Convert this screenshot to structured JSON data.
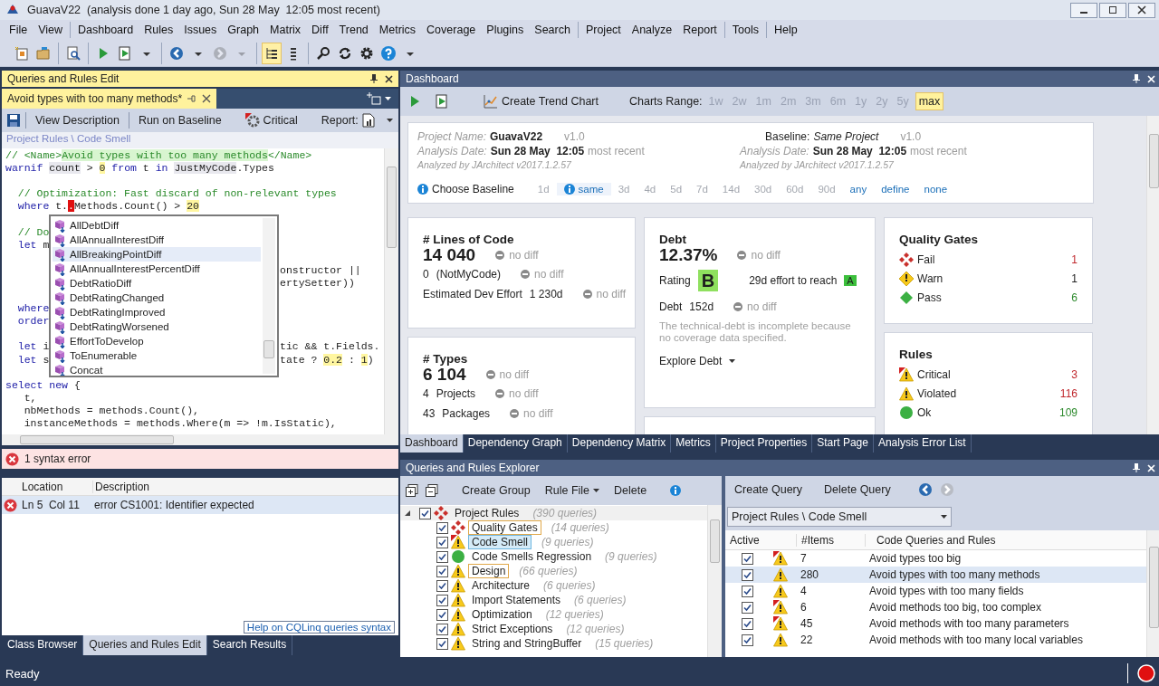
{
  "title_bar": {
    "title": "GuavaV22  (analysis done 1 day ago, Sun 28 May  12:05 most recent)"
  },
  "menu": [
    [
      "File",
      "View"
    ],
    [
      "Dashboard",
      "Rules",
      "Issues",
      "Graph",
      "Matrix",
      "Diff",
      "Trend",
      "Metrics",
      "Coverage",
      "Plugins",
      "Search"
    ],
    [
      "Project",
      "Analyze",
      "Report"
    ],
    [
      "Tools"
    ],
    [
      "Help"
    ]
  ],
  "toolbar": [
    [
      {
        "pressed": false,
        "disabled": false
      },
      {
        "pressed": false,
        "disabled": false
      }
    ],
    [
      {
        "pressed": false,
        "disabled": false
      }
    ],
    [
      {
        "pressed": false,
        "disabled": false
      },
      {
        "pressed": false,
        "disabled": false
      },
      {
        "pressed": false,
        "disabled": false
      }
    ],
    [
      {
        "pressed": false,
        "disabled": false
      },
      {
        "pressed": false,
        "disabled": false
      },
      {
        "pressed": false,
        "disabled": true
      },
      {
        "pressed": false,
        "disabled": true
      }
    ],
    [
      {
        "pressed": true,
        "disabled": false
      },
      {
        "pressed": false,
        "disabled": false
      }
    ],
    [
      {
        "pressed": false,
        "disabled": false
      },
      {
        "pressed": false,
        "disabled": false
      },
      {
        "pressed": false,
        "disabled": false
      },
      {
        "pressed": false,
        "disabled": false
      },
      {
        "pressed": false,
        "disabled": false
      }
    ]
  ],
  "query_editor": {
    "panel_title": "Queries and Rules Edit",
    "document_tab": "Avoid types with too many methods*",
    "toolbar": [
      "View Description",
      "Run on Baseline"
    ],
    "severity": "Critical",
    "report_label": "Report:",
    "breadcrumb": "Project Rules \\ Code Smell",
    "code_lines": [
      {
        "kind": "code",
        "left": [
          {
            "text": "// <Name>",
            "kind": "comment"
          },
          {
            "text": "Avoid types with too many methods",
            "kind": "name"
          },
          {
            "text": "</Name>",
            "kind": "comment"
          }
        ]
      },
      {
        "kind": "code",
        "left": [
          {
            "text": "warnif ",
            "kind": "keyword"
          },
          {
            "text": "count",
            "kind": "ident"
          },
          {
            "text": " > ",
            "kind": "plain"
          },
          {
            "text": "0",
            "kind": "number"
          },
          {
            "text": " from",
            "kind": "keyword"
          },
          {
            "text": " t ",
            "kind": "plain"
          },
          {
            "text": "in ",
            "kind": "keyword"
          },
          {
            "text": "JustMyCode",
            "kind": "ident"
          },
          {
            "text": ".Types",
            "kind": "plain"
          }
        ]
      },
      {
        "kind": "blank"
      },
      {
        "kind": "code",
        "left": [
          {
            "text": "  // Optimization: Fast discard of non-relevant types",
            "kind": "comment"
          }
        ]
      },
      {
        "kind": "code",
        "left": [
          {
            "text": "  where",
            "kind": "keyword"
          },
          {
            "text": " t.",
            "kind": "plain"
          },
          {
            "text": ".",
            "kind": "error"
          },
          {
            "text": "Methods.Count() > ",
            "kind": "plain"
          },
          {
            "text": "20",
            "kind": "number"
          }
        ]
      },
      {
        "kind": "blank"
      },
      {
        "kind": "code",
        "left": [
          {
            "text": "  // Do",
            "kind": "comment"
          }
        ]
      },
      {
        "kind": "code",
        "left": [
          {
            "text": "  let",
            "kind": "keyword"
          },
          {
            "text": " m",
            "kind": "plain"
          }
        ]
      },
      {
        "kind": "blank"
      },
      {
        "kind": "code",
        "right": [
          {
            "text": "onstructor ||",
            "kind": "plain"
          }
        ]
      },
      {
        "kind": "code",
        "right": [
          {
            "text": "ertySetter))",
            "kind": "plain"
          }
        ]
      },
      {
        "kind": "blank"
      },
      {
        "kind": "code",
        "left": [
          {
            "text": "  where",
            "kind": "keyword"
          }
        ]
      },
      {
        "kind": "code",
        "left": [
          {
            "text": "  order",
            "kind": "keyword"
          }
        ]
      },
      {
        "kind": "blank"
      },
      {
        "kind": "code",
        "left": [
          {
            "text": "  let",
            "kind": "keyword"
          },
          {
            "text": " i",
            "kind": "plain"
          }
        ],
        "right": [
          {
            "text": "tic && t.Fields.",
            "kind": "plain"
          }
        ]
      },
      {
        "kind": "code",
        "left": [
          {
            "text": "  let",
            "kind": "keyword"
          },
          {
            "text": " s",
            "kind": "plain"
          }
        ],
        "right": [
          {
            "text": "tate ? ",
            "kind": "plain"
          },
          {
            "text": "0.2",
            "kind": "number"
          },
          {
            "text": " : ",
            "kind": "plain"
          },
          {
            "text": "1",
            "kind": "number"
          },
          {
            "text": ")",
            "kind": "plain"
          }
        ]
      },
      {
        "kind": "blank"
      },
      {
        "kind": "code",
        "left": [
          {
            "text": "select new",
            "kind": "keyword"
          },
          {
            "text": " {",
            "kind": "plain"
          }
        ]
      },
      {
        "kind": "code",
        "left": [
          {
            "text": "   t,",
            "kind": "plain"
          }
        ]
      },
      {
        "kind": "code",
        "left": [
          {
            "text": "   nbMethods = methods.Count(),",
            "kind": "plain"
          }
        ]
      },
      {
        "kind": "code",
        "left": [
          {
            "text": "   instanceMethods = methods.Where(m => !m.IsStatic),",
            "kind": "plain"
          }
        ]
      }
    ],
    "completion": [
      {
        "label": "AllDebtDiff",
        "selected": false
      },
      {
        "label": "AllAnnualInterestDiff",
        "selected": false
      },
      {
        "label": "AllBreakingPointDiff",
        "selected": true
      },
      {
        "label": "AllAnnualInterestPercentDiff",
        "selected": false
      },
      {
        "label": "DebtRatioDiff",
        "selected": false
      },
      {
        "label": "DebtRatingChanged",
        "selected": false
      },
      {
        "label": "DebtRatingImproved",
        "selected": false
      },
      {
        "label": "DebtRatingWorsened",
        "selected": false
      },
      {
        "label": "EffortToDevelop",
        "selected": false
      },
      {
        "label": "ToEnumerable",
        "selected": false
      },
      {
        "label": "Concat",
        "selected": false
      }
    ],
    "status": "1 syntax error",
    "errors": {
      "columns": [
        "Location",
        "Description"
      ],
      "rows": [
        {
          "location": "Ln 5  Col 11",
          "description": "error CS1001: Identifier expected",
          "selected": true
        }
      ]
    },
    "help_link": "Help on CQLinq queries syntax"
  },
  "left_tabs": [
    {
      "label": "Class Browser",
      "selected": false
    },
    {
      "label": "Queries and Rules Edit",
      "selected": true
    },
    {
      "label": "Search Results",
      "selected": false
    }
  ],
  "dashboard": {
    "panel_title": "Dashboard",
    "trend_button": "Create Trend Chart",
    "range_label": "Charts Range:",
    "ranges": [
      {
        "label": "1w",
        "selected": false
      },
      {
        "label": "2w",
        "selected": false
      },
      {
        "label": "1m",
        "selected": false
      },
      {
        "label": "2m",
        "selected": false
      },
      {
        "label": "3m",
        "selected": false
      },
      {
        "label": "6m",
        "selected": false
      },
      {
        "label": "1y",
        "selected": false
      },
      {
        "label": "2y",
        "selected": false
      },
      {
        "label": "5y",
        "selected": false
      },
      {
        "label": "max",
        "selected": true
      }
    ],
    "project": {
      "name_label": "Project Name:",
      "name": "GuavaV22",
      "version": "v1.0",
      "date_label": "Analysis Date:",
      "date": "Sun 28 May  12:05",
      "date_note": "most recent",
      "analyzer": "Analyzed by JArchitect v2017.1.2.57"
    },
    "baseline": {
      "label": "Baseline:",
      "name": "Same Project",
      "version": "v1.0",
      "date_label": "Analysis Date:",
      "date": "Sun 28 May  12:05",
      "date_note": "most recent",
      "analyzer": "Analyzed by JArchitect v2017.1.2.57"
    },
    "choose_baseline": "Choose Baseline",
    "baseline_options": [
      {
        "label": "1d",
        "selected": false,
        "disabled": true
      },
      {
        "label": "same",
        "selected": true,
        "disabled": false
      },
      {
        "label": "3d",
        "selected": false,
        "disabled": true
      },
      {
        "label": "4d",
        "selected": false,
        "disabled": true
      },
      {
        "label": "5d",
        "selected": false,
        "disabled": true
      },
      {
        "label": "7d",
        "selected": false,
        "disabled": true
      },
      {
        "label": "14d",
        "selected": false,
        "disabled": true
      },
      {
        "label": "30d",
        "selected": false,
        "disabled": true
      },
      {
        "label": "60d",
        "selected": false,
        "disabled": true
      },
      {
        "label": "90d",
        "selected": false,
        "disabled": true
      },
      {
        "label": "any",
        "selected": false,
        "disabled": false
      },
      {
        "label": "define",
        "selected": false,
        "disabled": false
      },
      {
        "label": "none",
        "selected": false,
        "disabled": false
      }
    ],
    "lines_of_code": {
      "title": "# Lines of Code",
      "value": "14 040",
      "diff": "no diff",
      "rows": [
        {
          "parts": [
            "0",
            "(NotMyCode)"
          ],
          "diff": "no diff"
        },
        {
          "parts": [
            "Estimated Dev Effort",
            "1 230d"
          ],
          "diff": "no diff"
        }
      ]
    },
    "types": {
      "title": "# Types",
      "value": "6 104",
      "diff": "no diff",
      "rows": [
        {
          "parts": [
            "4",
            "Projects"
          ],
          "diff": "no diff"
        },
        {
          "parts": [
            "43",
            "Packages"
          ],
          "diff": "no diff"
        }
      ]
    },
    "debt": {
      "title": "Debt",
      "value": "12.37%",
      "diff": "no diff",
      "rating_label": "Rating",
      "rating": "B",
      "effort": "29d effort to reach",
      "target_rating": "A",
      "row": {
        "parts": [
          "Debt",
          "152d"
        ],
        "diff": "no diff"
      },
      "note": "The technical-debt is incomplete because no coverage data specified.",
      "explore": "Explore Debt"
    },
    "quality_gates": {
      "title": "Quality Gates",
      "rows": [
        {
          "kind": "fail",
          "label": "Fail",
          "count": "1"
        },
        {
          "kind": "warning",
          "label": "Warn",
          "count": "1"
        },
        {
          "kind": "pass",
          "label": "Pass",
          "count": "6"
        }
      ]
    },
    "rules": {
      "title": "Rules",
      "rows": [
        {
          "kind": "critical",
          "label": "Critical",
          "count": "3"
        },
        {
          "kind": "violated",
          "label": "Violated",
          "count": "116"
        },
        {
          "kind": "ok",
          "label": "Ok",
          "count": "109"
        }
      ]
    },
    "tabs": [
      {
        "label": "Dashboard",
        "selected": true
      },
      {
        "label": "Dependency Graph",
        "selected": false
      },
      {
        "label": "Dependency Matrix",
        "selected": false
      },
      {
        "label": "Metrics",
        "selected": false
      },
      {
        "label": "Project Properties",
        "selected": false
      },
      {
        "label": "Start Page",
        "selected": false
      },
      {
        "label": "Analysis Error List",
        "selected": false
      }
    ]
  },
  "explorer": {
    "panel_title": "Queries and Rules Explorer",
    "toolbar": [
      "Create Group",
      "Rule File",
      "Delete"
    ],
    "tree": {
      "label": "Project Rules",
      "count": "(390 queries)",
      "kind": "fail",
      "checked": true,
      "expanded": true,
      "children": [
        {
          "label": "Quality Gates",
          "count": "(14 queries)",
          "kind": "fail",
          "checked": true,
          "selected": false,
          "outlined": true
        },
        {
          "label": "Code Smell",
          "count": "(9 queries)",
          "kind": "critical",
          "checked": true,
          "selected": true,
          "outlined": false
        },
        {
          "label": "Code Smells Regression",
          "count": "(9 queries)",
          "kind": "ok",
          "checked": true,
          "selected": false,
          "outlined": false
        },
        {
          "label": "Design",
          "count": "(66 queries)",
          "kind": "violated",
          "checked": true,
          "selected": false,
          "outlined": true
        },
        {
          "label": "Architecture",
          "count": "(6 queries)",
          "kind": "violated",
          "checked": true,
          "selected": false,
          "outlined": false
        },
        {
          "label": "Import Statements",
          "count": "(6 queries)",
          "kind": "violated",
          "checked": true,
          "selected": false,
          "outlined": false
        },
        {
          "label": "Optimization",
          "count": "(12 queries)",
          "kind": "violated",
          "checked": true,
          "selected": false,
          "outlined": false
        },
        {
          "label": "Strict Exceptions",
          "count": "(12 queries)",
          "kind": "violated",
          "checked": true,
          "selected": false,
          "outlined": false
        },
        {
          "label": "String and StringBuffer",
          "count": "(15 queries)",
          "kind": "violated",
          "checked": true,
          "selected": false,
          "outlined": false
        }
      ]
    },
    "query_toolbar": [
      "Create Query",
      "Delete Query"
    ],
    "group": "Project Rules \\ Code Smell",
    "columns": [
      "Active",
      "#Items",
      "Code Queries and Rules"
    ],
    "rows": [
      {
        "active": true,
        "kind": "critical",
        "items": "7",
        "name": "Avoid types too big",
        "selected": false
      },
      {
        "active": true,
        "kind": "violated",
        "items": "280",
        "name": "Avoid types with too many methods",
        "selected": true
      },
      {
        "active": true,
        "kind": "violated",
        "items": "4",
        "name": "Avoid types with too many fields",
        "selected": false
      },
      {
        "active": true,
        "kind": "critical",
        "items": "6",
        "name": "Avoid methods too big, too complex",
        "selected": false
      },
      {
        "active": true,
        "kind": "critical",
        "items": "45",
        "name": "Avoid methods with too many parameters",
        "selected": false
      },
      {
        "active": true,
        "kind": "violated",
        "items": "22",
        "name": "Avoid methods with too many local variables",
        "selected": false
      }
    ]
  },
  "status_bar": {
    "text": "Ready"
  }
}
